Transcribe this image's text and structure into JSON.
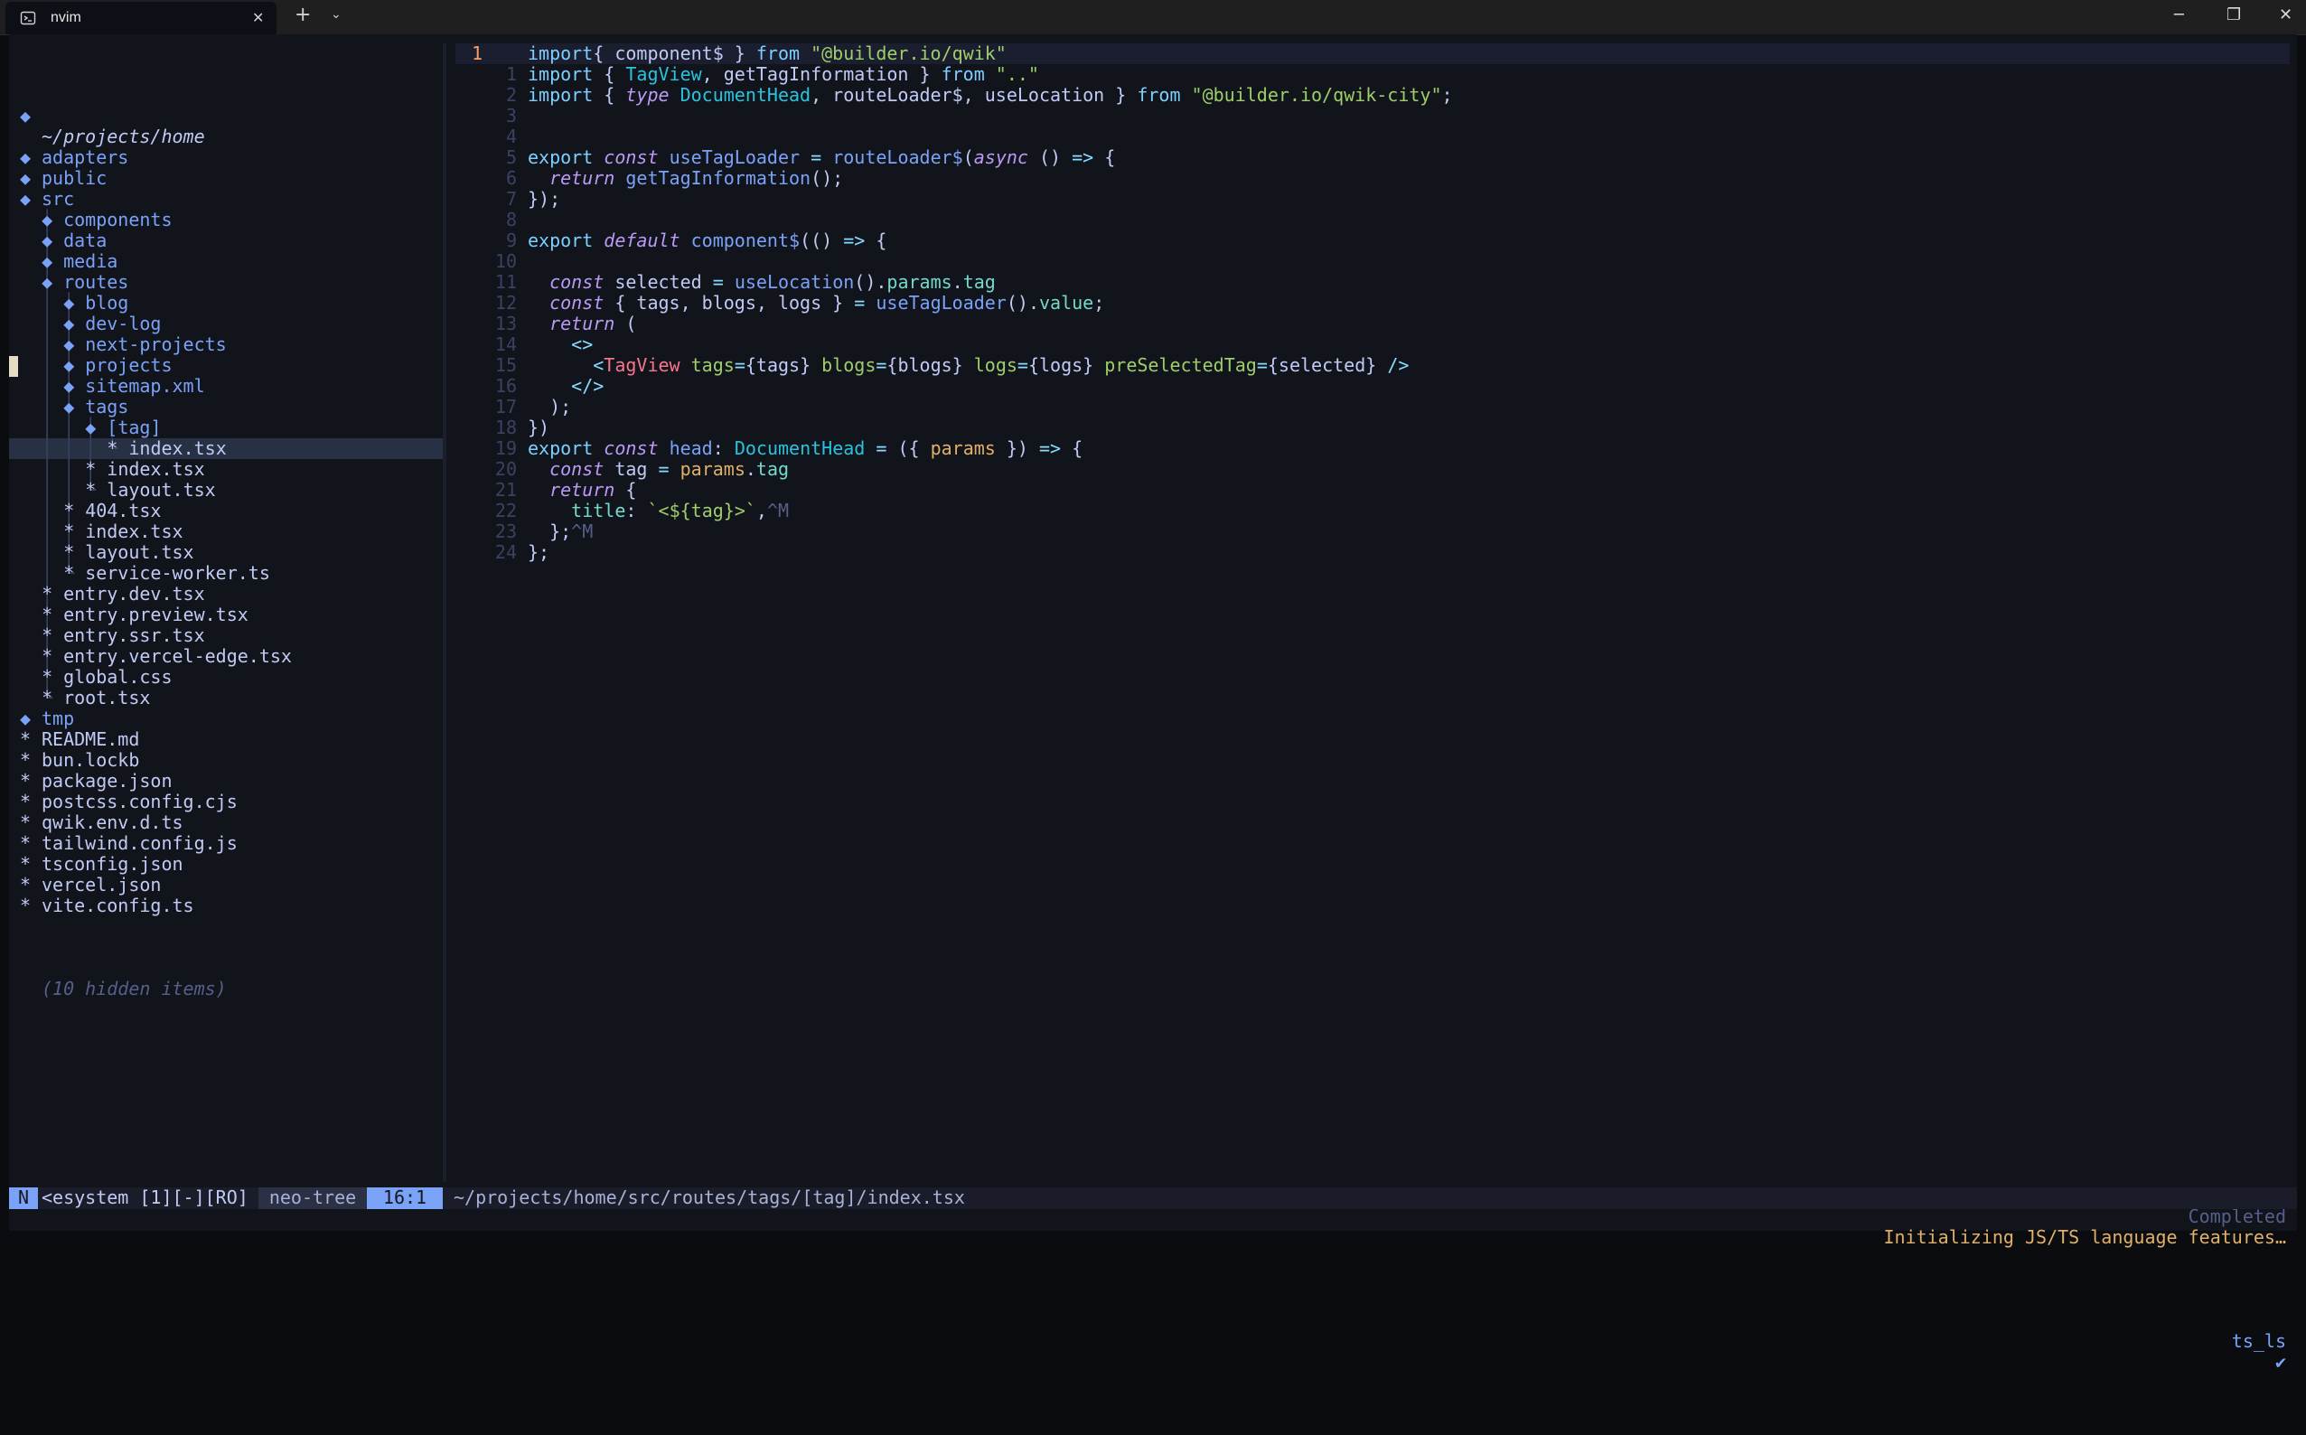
{
  "window": {
    "tab_title": "nvim",
    "tab_close": "✕",
    "new_tab": "+",
    "tab_dropdown": "⌄",
    "minimize": "─",
    "maximize": "❐",
    "close": "✕"
  },
  "tree": {
    "root": "~/projects/home",
    "hidden_note": "(10 hidden items)",
    "rows": [
      {
        "guide": "",
        "icon": "◆",
        "label": "adapters"
      },
      {
        "guide": "",
        "icon": "◆",
        "label": "public"
      },
      {
        "guide": "",
        "icon": "◆",
        "label": "src"
      },
      {
        "guide": "│ ",
        "icon": "◆",
        "label": "components"
      },
      {
        "guide": "│ ",
        "icon": "◆",
        "label": "data"
      },
      {
        "guide": "│ ",
        "icon": "◆",
        "label": "media"
      },
      {
        "guide": "│ ",
        "icon": "◆",
        "label": "routes"
      },
      {
        "guide": "│ │ ",
        "icon": "◆",
        "label": "blog"
      },
      {
        "guide": "│ │ ",
        "icon": "◆",
        "label": "dev-log"
      },
      {
        "guide": "│ │ ",
        "icon": "◆",
        "label": "next-projects"
      },
      {
        "guide": "│ │ ",
        "icon": "◆",
        "label": "projects"
      },
      {
        "guide": "│ │ ",
        "icon": "◆",
        "label": "sitemap.xml"
      },
      {
        "guide": "│ │ ",
        "icon": "◆",
        "label": "tags"
      },
      {
        "guide": "│ │ │ ",
        "icon": "◆",
        "label": "[tag]"
      },
      {
        "guide": "│ │ │ └ ",
        "icon": "*",
        "label": "index.tsx",
        "file": true,
        "selected": true
      },
      {
        "guide": "│ │ │ ",
        "icon": "*",
        "label": "index.tsx",
        "file": true
      },
      {
        "guide": "│ │ └ ",
        "icon": "*",
        "label": "layout.tsx",
        "file": true
      },
      {
        "guide": "│ │ ",
        "icon": "*",
        "label": "404.tsx",
        "file": true
      },
      {
        "guide": "│ │ ",
        "icon": "*",
        "label": "index.tsx",
        "file": true
      },
      {
        "guide": "│ │ ",
        "icon": "*",
        "label": "layout.tsx",
        "file": true
      },
      {
        "guide": "│ └ ",
        "icon": "*",
        "label": "service-worker.ts",
        "file": true
      },
      {
        "guide": "│ ",
        "icon": "*",
        "label": "entry.dev.tsx",
        "file": true
      },
      {
        "guide": "│ ",
        "icon": "*",
        "label": "entry.preview.tsx",
        "file": true
      },
      {
        "guide": "│ ",
        "icon": "*",
        "label": "entry.ssr.tsx",
        "file": true
      },
      {
        "guide": "│ ",
        "icon": "*",
        "label": "entry.vercel-edge.tsx",
        "file": true
      },
      {
        "guide": "│ ",
        "icon": "*",
        "label": "global.css",
        "file": true
      },
      {
        "guide": "└ ",
        "icon": "*",
        "label": "root.tsx",
        "file": true
      },
      {
        "guide": "",
        "icon": "◆",
        "label": "tmp"
      },
      {
        "guide": "",
        "icon": "*",
        "label": "README.md",
        "file": true
      },
      {
        "guide": "",
        "icon": "*",
        "label": "bun.lockb",
        "file": true
      },
      {
        "guide": "",
        "icon": "*",
        "label": "package.json",
        "file": true
      },
      {
        "guide": "",
        "icon": "*",
        "label": "postcss.config.cjs",
        "file": true
      },
      {
        "guide": "",
        "icon": "*",
        "label": "qwik.env.d.ts",
        "file": true
      },
      {
        "guide": "",
        "icon": "*",
        "label": "tailwind.config.js",
        "file": true
      },
      {
        "guide": "",
        "icon": "*",
        "label": "tsconfig.json",
        "file": true
      },
      {
        "guide": "",
        "icon": "*",
        "label": "vercel.json",
        "file": true
      },
      {
        "guide": "",
        "icon": "*",
        "label": "vite.config.ts",
        "file": true
      }
    ]
  },
  "editor": {
    "lines": [
      {
        "n": "1",
        "cursor": true,
        "segs": [
          [
            "kw",
            "import"
          ],
          [
            "",
            "{ component$ } "
          ],
          [
            "kw",
            "from"
          ],
          [
            "",
            " "
          ],
          [
            "str",
            "\"@builder.io/qwik\""
          ]
        ]
      },
      {
        "n": "1",
        "segs": [
          [
            "kw",
            "import"
          ],
          [
            "",
            " { "
          ],
          [
            "typ",
            "TagView"
          ],
          [
            "",
            ", getTagInformation } "
          ],
          [
            "kw",
            "from"
          ],
          [
            "",
            " "
          ],
          [
            "str",
            "\"..\""
          ]
        ]
      },
      {
        "n": "2",
        "segs": [
          [
            "kw",
            "import"
          ],
          [
            "",
            " { "
          ],
          [
            "kwi",
            "type"
          ],
          [
            "",
            " "
          ],
          [
            "typ",
            "DocumentHead"
          ],
          [
            "",
            ", routeLoader$, useLocation } "
          ],
          [
            "kw",
            "from"
          ],
          [
            "",
            " "
          ],
          [
            "str",
            "\"@builder.io/qwik-city\""
          ],
          [
            "",
            ";"
          ]
        ]
      },
      {
        "n": "3",
        "segs": []
      },
      {
        "n": "4",
        "segs": []
      },
      {
        "n": "5",
        "segs": [
          [
            "kw",
            "export"
          ],
          [
            "",
            " "
          ],
          [
            "kwi",
            "const"
          ],
          [
            "",
            " "
          ],
          [
            "fn",
            "useTagLoader"
          ],
          [
            "",
            " "
          ],
          [
            "op",
            "="
          ],
          [
            "",
            " "
          ],
          [
            "fn",
            "routeLoader$"
          ],
          [
            "",
            "("
          ],
          [
            "kwi",
            "async"
          ],
          [
            "",
            " () "
          ],
          [
            "op",
            "=>"
          ],
          [
            "",
            " {"
          ]
        ]
      },
      {
        "n": "6",
        "segs": [
          [
            "",
            "  "
          ],
          [
            "kwi",
            "return"
          ],
          [
            "",
            " "
          ],
          [
            "fn",
            "getTagInformation"
          ],
          [
            "",
            "();"
          ]
        ]
      },
      {
        "n": "7",
        "segs": [
          [
            "",
            "});"
          ]
        ]
      },
      {
        "n": "8",
        "segs": []
      },
      {
        "n": "9",
        "segs": [
          [
            "kw",
            "export"
          ],
          [
            "",
            " "
          ],
          [
            "kwi",
            "default"
          ],
          [
            "",
            " "
          ],
          [
            "fn",
            "component$"
          ],
          [
            "",
            "(() "
          ],
          [
            "op",
            "=>"
          ],
          [
            "",
            " {"
          ]
        ]
      },
      {
        "n": "10",
        "segs": []
      },
      {
        "n": "11",
        "segs": [
          [
            "",
            "  "
          ],
          [
            "kwi",
            "const"
          ],
          [
            "",
            " selected "
          ],
          [
            "op",
            "="
          ],
          [
            "",
            " "
          ],
          [
            "fn",
            "useLocation"
          ],
          [
            "",
            "()."
          ],
          [
            "prop",
            "params"
          ],
          [
            "",
            "."
          ],
          [
            "prop",
            "tag"
          ]
        ]
      },
      {
        "n": "12",
        "segs": [
          [
            "",
            "  "
          ],
          [
            "kwi",
            "const"
          ],
          [
            "",
            " { tags, blogs, logs } "
          ],
          [
            "op",
            "="
          ],
          [
            "",
            " "
          ],
          [
            "fn",
            "useTagLoader"
          ],
          [
            "",
            "()."
          ],
          [
            "prop",
            "value"
          ],
          [
            "",
            ";"
          ]
        ]
      },
      {
        "n": "13",
        "segs": [
          [
            "",
            "  "
          ],
          [
            "kwi",
            "return"
          ],
          [
            "",
            " ("
          ]
        ]
      },
      {
        "n": "14",
        "segs": [
          [
            "",
            "    "
          ],
          [
            "op",
            "<>"
          ]
        ]
      },
      {
        "n": "15",
        "segs": [
          [
            "",
            "      "
          ],
          [
            "op",
            "<"
          ],
          [
            "tag",
            "TagView"
          ],
          [
            "",
            " "
          ],
          [
            "attr",
            "tags"
          ],
          [
            "op",
            "="
          ],
          [
            "",
            "{tags} "
          ],
          [
            "attr",
            "blogs"
          ],
          [
            "op",
            "="
          ],
          [
            "",
            "{blogs} "
          ],
          [
            "attr",
            "logs"
          ],
          [
            "op",
            "="
          ],
          [
            "",
            "{logs} "
          ],
          [
            "attr",
            "preSelectedTag"
          ],
          [
            "op",
            "="
          ],
          [
            "",
            "{selected} "
          ],
          [
            "op",
            "/>"
          ]
        ]
      },
      {
        "n": "16",
        "segs": [
          [
            "",
            "    "
          ],
          [
            "op",
            "</>"
          ]
        ]
      },
      {
        "n": "17",
        "segs": [
          [
            "",
            "  );"
          ]
        ]
      },
      {
        "n": "18",
        "segs": [
          [
            "",
            "})"
          ]
        ]
      },
      {
        "n": "19",
        "segs": [
          [
            "kw",
            "export"
          ],
          [
            "",
            " "
          ],
          [
            "kwi",
            "const"
          ],
          [
            "",
            " "
          ],
          [
            "fn",
            "head"
          ],
          [
            "",
            ": "
          ],
          [
            "typ",
            "DocumentHead"
          ],
          [
            "",
            " "
          ],
          [
            "op",
            "="
          ],
          [
            "",
            " ({ "
          ],
          [
            "param",
            "params"
          ],
          [
            "",
            " }) "
          ],
          [
            "op",
            "=>"
          ],
          [
            "",
            " {"
          ]
        ]
      },
      {
        "n": "20",
        "segs": [
          [
            "",
            "  "
          ],
          [
            "kwi",
            "const"
          ],
          [
            "",
            " tag "
          ],
          [
            "op",
            "="
          ],
          [
            "",
            " "
          ],
          [
            "param",
            "params"
          ],
          [
            "",
            "."
          ],
          [
            "prop",
            "tag"
          ]
        ]
      },
      {
        "n": "21",
        "segs": [
          [
            "",
            "  "
          ],
          [
            "kwi",
            "return"
          ],
          [
            "",
            " {"
          ]
        ]
      },
      {
        "n": "22",
        "segs": [
          [
            "",
            "    "
          ],
          [
            "prop",
            "title"
          ],
          [
            "",
            ": "
          ],
          [
            "str",
            "`<${tag}>`"
          ],
          [
            "",
            ","
          ],
          [
            "ctrl",
            "^M"
          ]
        ]
      },
      {
        "n": "23",
        "segs": [
          [
            "",
            "  };"
          ],
          [
            "ctrl",
            "^M"
          ]
        ]
      },
      {
        "n": "24",
        "segs": [
          [
            "",
            "};"
          ]
        ]
      }
    ]
  },
  "notification": {
    "completed": "Completed",
    "message": "Initializing JS/TS language features…",
    "lsp": "ts_ls",
    "check": "✔"
  },
  "statusline": {
    "mode": "N",
    "buffer": "<esystem [1][-][RO]",
    "name": "neo-tree",
    "position": "16:1",
    "path": "~/projects/home/src/routes/tags/[tag]/index.tsx"
  }
}
